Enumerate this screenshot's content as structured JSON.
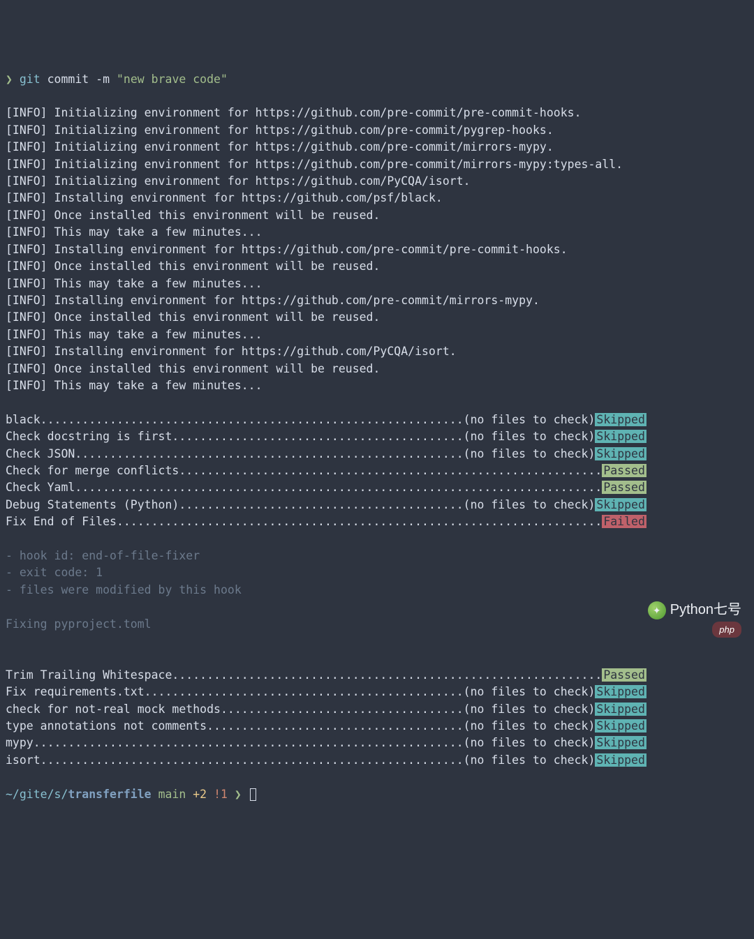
{
  "prompt": {
    "chevron": "❯",
    "command": "git",
    "args": "commit -m",
    "string": "\"new brave code\""
  },
  "info_lines": [
    "[INFO] Initializing environment for https://github.com/pre-commit/pre-commit-hooks.",
    "[INFO] Initializing environment for https://github.com/pre-commit/pygrep-hooks.",
    "[INFO] Initializing environment for https://github.com/pre-commit/mirrors-mypy.",
    "[INFO] Initializing environment for https://github.com/pre-commit/mirrors-mypy:types-all.",
    "[INFO] Initializing environment for https://github.com/PyCQA/isort.",
    "[INFO] Installing environment for https://github.com/psf/black.",
    "[INFO] Once installed this environment will be reused.",
    "[INFO] This may take a few minutes...",
    "[INFO] Installing environment for https://github.com/pre-commit/pre-commit-hooks.",
    "[INFO] Once installed this environment will be reused.",
    "[INFO] This may take a few minutes...",
    "[INFO] Installing environment for https://github.com/pre-commit/mirrors-mypy.",
    "[INFO] Once installed this environment will be reused.",
    "[INFO] This may take a few minutes...",
    "[INFO] Installing environment for https://github.com/PyCQA/isort.",
    "[INFO] Once installed this environment will be reused.",
    "[INFO] This may take a few minutes..."
  ],
  "hooks1": [
    {
      "name": "black",
      "note": "(no files to check)",
      "status": "Skipped"
    },
    {
      "name": "Check docstring is first",
      "note": "(no files to check)",
      "status": "Skipped"
    },
    {
      "name": "Check JSON",
      "note": "(no files to check)",
      "status": "Skipped"
    },
    {
      "name": "Check for merge conflicts",
      "note": "",
      "status": "Passed"
    },
    {
      "name": "Check Yaml",
      "note": "",
      "status": "Passed"
    },
    {
      "name": "Debug Statements (Python)",
      "note": "(no files to check)",
      "status": "Skipped"
    },
    {
      "name": "Fix End of Files",
      "note": "",
      "status": "Failed"
    }
  ],
  "fail_detail": [
    "- hook id: end-of-file-fixer",
    "- exit code: 1",
    "- files were modified by this hook",
    "",
    "Fixing pyproject.toml",
    ""
  ],
  "hooks2": [
    {
      "name": "Trim Trailing Whitespace",
      "note": "",
      "status": "Passed"
    },
    {
      "name": "Fix requirements.txt",
      "note": "(no files to check)",
      "status": "Skipped"
    },
    {
      "name": "check for not-real mock methods",
      "note": "(no files to check)",
      "status": "Skipped"
    },
    {
      "name": "type annotations not comments",
      "note": "(no files to check)",
      "status": "Skipped"
    },
    {
      "name": "mypy",
      "note": "(no files to check)",
      "status": "Skipped"
    },
    {
      "name": "isort",
      "note": "(no files to check)",
      "status": "Skipped"
    }
  ],
  "bottom_prompt": {
    "path_dim": "~/gite/s/",
    "path_bright": "transferfile",
    "branch": "main",
    "plus": "+2",
    "excl": "!1",
    "chevron": "❯"
  },
  "watermark": {
    "text": "Python七号",
    "badge": "php"
  },
  "layout": {
    "line_width": 92
  }
}
